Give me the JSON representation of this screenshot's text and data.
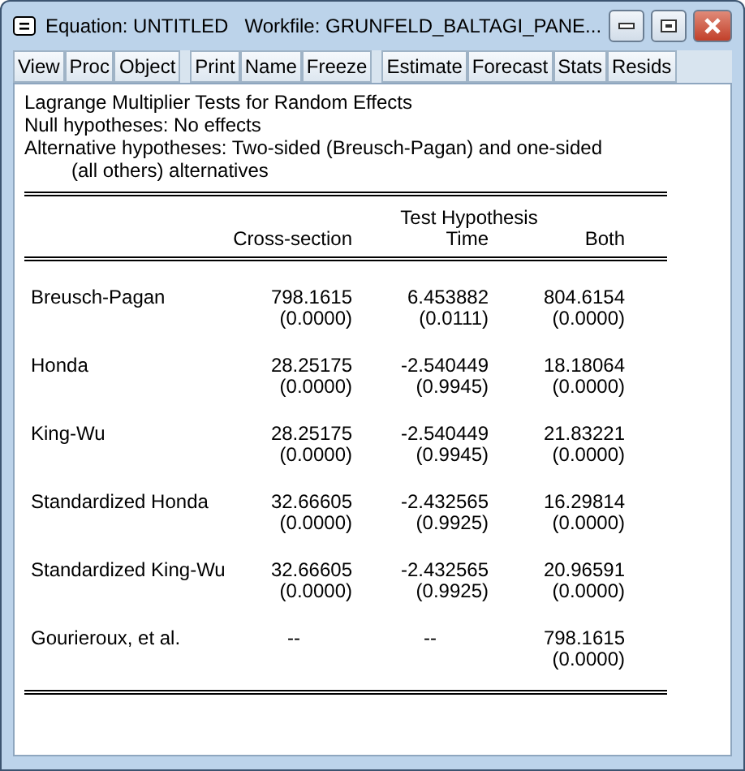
{
  "window": {
    "title": "Equation: UNTITLED   Workfile: GRUNFELD_BALTAGI_PANE..."
  },
  "toolbar": [
    [
      "View",
      "Proc",
      "Object"
    ],
    [
      "Print",
      "Name",
      "Freeze"
    ],
    [
      "Estimate",
      "Forecast",
      "Stats",
      "Resids"
    ]
  ],
  "output": {
    "heading": [
      "Lagrange Multiplier Tests for Random Effects",
      "Null hypotheses: No effects",
      "Alternative hypotheses: Two-sided (Breusch-Pagan) and one-sided"
    ],
    "heading_continued": "(all others) alternatives",
    "table": {
      "group_header": "Test Hypothesis",
      "columns": [
        "Cross-section",
        "Time",
        "Both"
      ],
      "rows": [
        {
          "label": "Breusch-Pagan",
          "cells": [
            {
              "value": "798.1615",
              "pvalue": "(0.0000)"
            },
            {
              "value": "6.453882",
              "pvalue": "(0.0111)"
            },
            {
              "value": "804.6154",
              "pvalue": "(0.0000)"
            }
          ]
        },
        {
          "label": "Honda",
          "cells": [
            {
              "value": "28.25175",
              "pvalue": "(0.0000)"
            },
            {
              "value": "-2.540449",
              "pvalue": "(0.9945)"
            },
            {
              "value": "18.18064",
              "pvalue": "(0.0000)"
            }
          ]
        },
        {
          "label": "King-Wu",
          "cells": [
            {
              "value": "28.25175",
              "pvalue": "(0.0000)"
            },
            {
              "value": "-2.540449",
              "pvalue": "(0.9945)"
            },
            {
              "value": "21.83221",
              "pvalue": "(0.0000)"
            }
          ]
        },
        {
          "label": "Standardized Honda",
          "cells": [
            {
              "value": "32.66605",
              "pvalue": "(0.0000)"
            },
            {
              "value": "-2.432565",
              "pvalue": "(0.9925)"
            },
            {
              "value": "16.29814",
              "pvalue": "(0.0000)"
            }
          ]
        },
        {
          "label": "Standardized King-Wu",
          "cells": [
            {
              "value": "32.66605",
              "pvalue": "(0.0000)"
            },
            {
              "value": "-2.432565",
              "pvalue": "(0.9925)"
            },
            {
              "value": "20.96591",
              "pvalue": "(0.0000)"
            }
          ]
        },
        {
          "label": "Gourieroux, et al.",
          "cells": [
            {
              "value": "--"
            },
            {
              "value": "--"
            },
            {
              "value": "798.1615",
              "pvalue": "(0.0000)"
            }
          ]
        }
      ]
    }
  }
}
